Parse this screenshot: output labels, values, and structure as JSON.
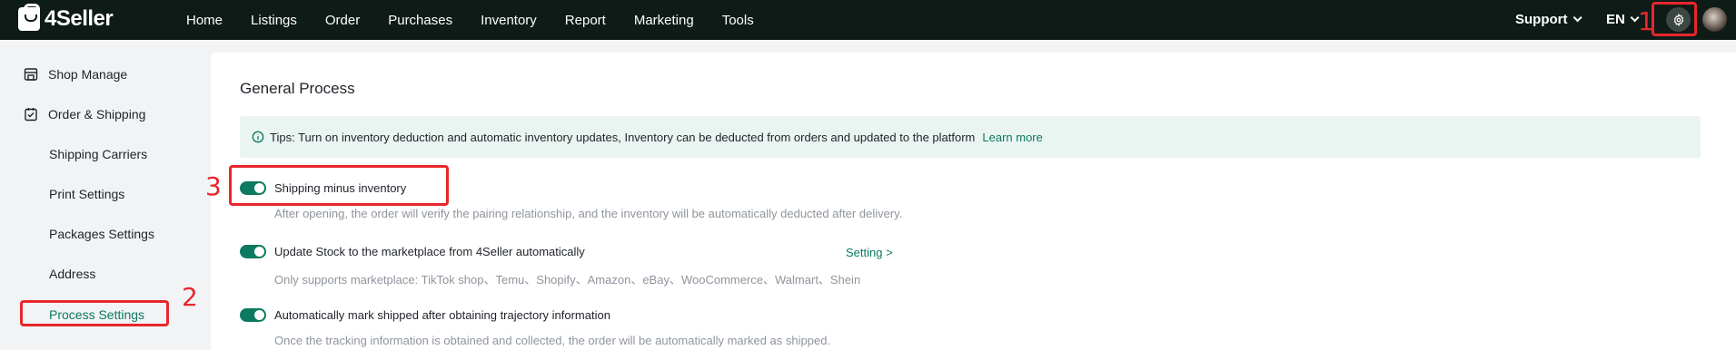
{
  "brand": {
    "name": "4Seller"
  },
  "nav": {
    "items": [
      {
        "label": "Home"
      },
      {
        "label": "Listings"
      },
      {
        "label": "Order"
      },
      {
        "label": "Purchases"
      },
      {
        "label": "Inventory"
      },
      {
        "label": "Report"
      },
      {
        "label": "Marketing"
      },
      {
        "label": "Tools"
      }
    ],
    "support_label": "Support",
    "language_label": "EN"
  },
  "sidebar": {
    "items": [
      {
        "label": "Shop Manage",
        "icon": "shop-icon"
      },
      {
        "label": "Order & Shipping",
        "icon": "order-shipping-icon"
      },
      {
        "label": "Shipping Carriers"
      },
      {
        "label": "Print Settings"
      },
      {
        "label": "Packages Settings"
      },
      {
        "label": "Address"
      },
      {
        "label": "Process Settings",
        "active": true
      }
    ]
  },
  "main": {
    "title": "General Process",
    "tips": {
      "text": "Tips: Turn on inventory deduction and automatic inventory updates, Inventory can be deducted from orders and updated to the platform",
      "link": "Learn more"
    },
    "options": [
      {
        "label": "Shipping minus inventory",
        "enabled": true,
        "description": "After opening, the order will verify the pairing relationship, and the inventory will be automatically deducted after delivery."
      },
      {
        "label": "Update Stock to the marketplace from 4Seller automatically",
        "enabled": true,
        "link": "Setting >",
        "description": "Only supports marketplace: TikTok shop、Temu、Shopify、Amazon、eBay、WooCommerce、Walmart、Shein"
      },
      {
        "label": "Automatically mark shipped after obtaining trajectory information",
        "enabled": true,
        "description": "Once the tracking information is obtained and collected, the order will be automatically marked as shipped."
      }
    ]
  },
  "annotations": [
    {
      "number": "1"
    },
    {
      "number": "2"
    },
    {
      "number": "3"
    }
  ],
  "colors": {
    "topbar": "#0e1b17",
    "accent": "#0b7a61",
    "annotation": "#e8262d",
    "tips_bg": "#eaf4f1"
  }
}
